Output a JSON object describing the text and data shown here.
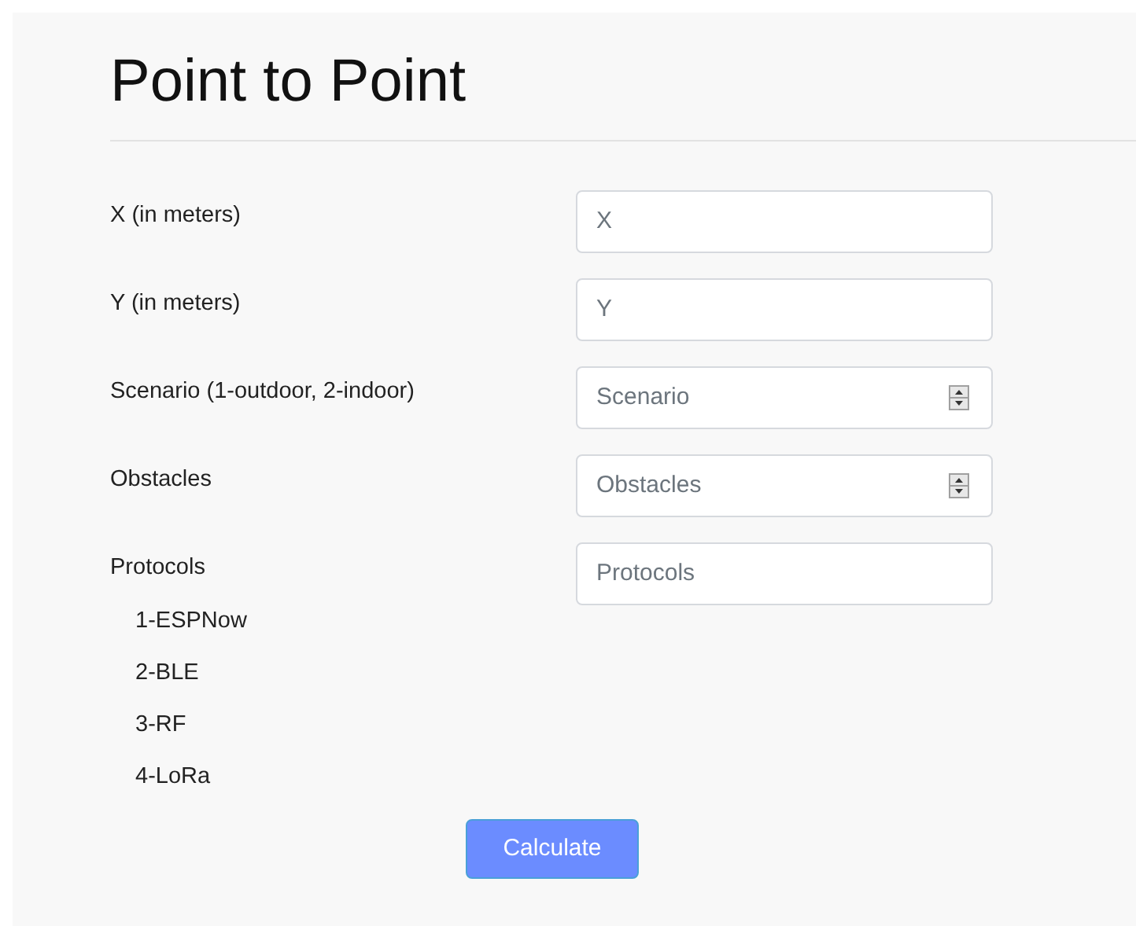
{
  "title": "Point to Point",
  "fields": [
    {
      "label": "X (in meters)",
      "placeholder": "X",
      "kind": "text"
    },
    {
      "label": "Y (in meters)",
      "placeholder": "Y",
      "kind": "text"
    },
    {
      "label": "Scenario (1-outdoor, 2-indoor)",
      "placeholder": "Scenario",
      "kind": "number"
    },
    {
      "label": "Obstacles",
      "placeholder": "Obstacles",
      "kind": "number"
    },
    {
      "label": "Protocols",
      "placeholder": "Protocols",
      "kind": "text",
      "options": [
        "1-ESPNow",
        "2-BLE",
        "3-RF",
        "4-LoRa"
      ]
    }
  ],
  "button": "Calculate"
}
